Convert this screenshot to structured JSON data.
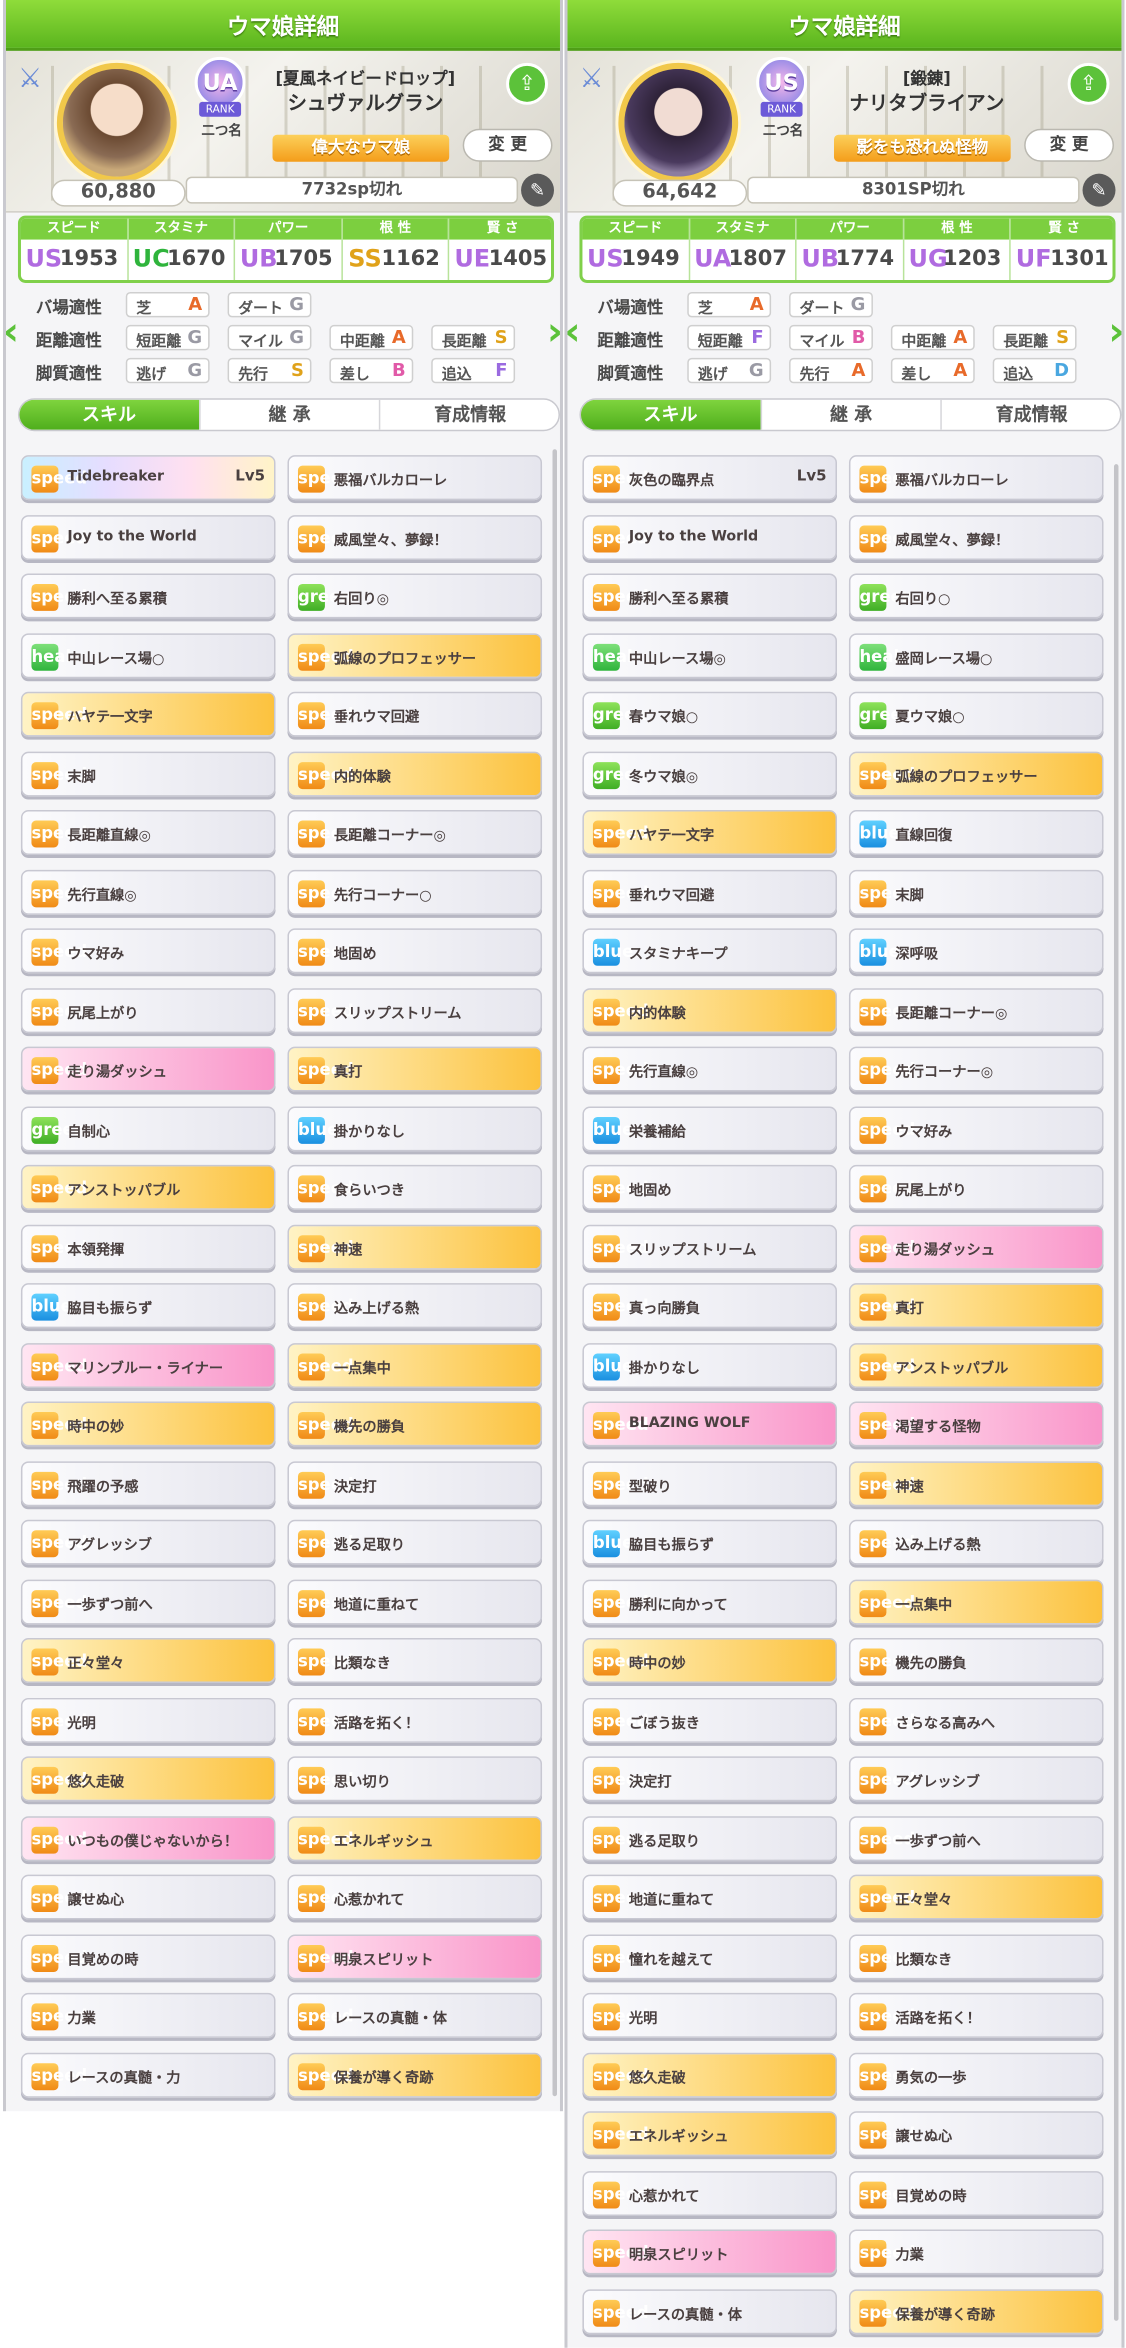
{
  "panels": [
    {
      "title": "ウマ娘詳細",
      "fans": "60,880",
      "rank_badge": "UA",
      "rank_badge_num": "7",
      "rank_label": "RANK",
      "rank_title": "二つ名",
      "epithet": "[夏風ネイビードロップ]",
      "name": "シュヴァルグラン",
      "title_badge": "偉大なウマ娘",
      "change_label": "変 更",
      "sp": "7732sp切れ",
      "stats": [
        {
          "label": "スピード",
          "grade": "US",
          "grade_sub": "5",
          "value": "1953",
          "color": "#b06be0"
        },
        {
          "label": "スタミナ",
          "grade": "UC",
          "grade_sub": "",
          "value": "1670",
          "color": "#2fb43c"
        },
        {
          "label": "パワー",
          "grade": "UB",
          "grade_sub": "",
          "value": "1705",
          "color": "#b06be0"
        },
        {
          "label": "根 性",
          "grade": "SS",
          "grade_sub": "",
          "value": "1162",
          "color": "#e0a21a"
        },
        {
          "label": "賢 さ",
          "grade": "UE",
          "grade_sub": "",
          "value": "1405",
          "color": "#b06be0"
        }
      ],
      "aptitude": [
        {
          "label": "バ場適性",
          "cells": [
            [
              "芝",
              "A"
            ],
            [
              "ダート",
              "G"
            ]
          ]
        },
        {
          "label": "距離適性",
          "cells": [
            [
              "短距離",
              "G"
            ],
            [
              "マイル",
              "G"
            ],
            [
              "中距離",
              "A"
            ],
            [
              "長距離",
              "S"
            ]
          ]
        },
        {
          "label": "脚質適性",
          "cells": [
            [
              "逃げ",
              "G"
            ],
            [
              "先行",
              "S"
            ],
            [
              "差し",
              "B"
            ],
            [
              "追込",
              "F"
            ]
          ]
        }
      ],
      "tabs": [
        "スキル",
        "継 承",
        "育成情報"
      ],
      "skills": [
        [
          "Tidebreaker",
          "rainbow",
          "speed",
          "Lv5"
        ],
        [
          "悪福バルカローレ",
          "white",
          "speed",
          ""
        ],
        [
          "Joy to the World",
          "white",
          "speed",
          ""
        ],
        [
          "威風堂々、夢録！",
          "white",
          "speed",
          ""
        ],
        [
          "勝利へ至る累積",
          "white",
          "speed",
          ""
        ],
        [
          "右回り◎",
          "white",
          "green",
          ""
        ],
        [
          "中山レース場○",
          "white",
          "heal",
          ""
        ],
        [
          "弧線のプロフェッサー",
          "gold",
          "speed",
          ""
        ],
        [
          "ハヤテ一文字",
          "gold",
          "speed",
          ""
        ],
        [
          "垂れウマ回避",
          "white",
          "speed",
          ""
        ],
        [
          "末脚",
          "white",
          "speed",
          ""
        ],
        [
          "内的体験",
          "gold",
          "speed",
          ""
        ],
        [
          "長距離直線◎",
          "white",
          "speed",
          ""
        ],
        [
          "長距離コーナー◎",
          "white",
          "speed",
          ""
        ],
        [
          "先行直線◎",
          "white",
          "speed",
          ""
        ],
        [
          "先行コーナー○",
          "white",
          "speed",
          ""
        ],
        [
          "ウマ好み",
          "white",
          "speed",
          ""
        ],
        [
          "地固め",
          "white",
          "speed",
          ""
        ],
        [
          "尻尾上がり",
          "white",
          "speed",
          ""
        ],
        [
          "スリップストリーム",
          "white",
          "speed",
          ""
        ],
        [
          "走り湯ダッシュ",
          "pink",
          "speed",
          ""
        ],
        [
          "真打",
          "gold",
          "speed",
          ""
        ],
        [
          "自制心",
          "white",
          "green",
          ""
        ],
        [
          "掛かりなし",
          "white",
          "blue",
          ""
        ],
        [
          "アンストッパブル",
          "gold",
          "speed",
          ""
        ],
        [
          "食らいつき",
          "white",
          "speed",
          ""
        ],
        [
          "本領発揮",
          "white",
          "speed",
          ""
        ],
        [
          "神速",
          "gold",
          "speed",
          ""
        ],
        [
          "脇目も振らず",
          "white",
          "blue",
          ""
        ],
        [
          "込み上げる熱",
          "white",
          "speed",
          ""
        ],
        [
          "マリンブルー・ライナー",
          "pink",
          "speed",
          ""
        ],
        [
          "一点集中",
          "gold",
          "speed",
          ""
        ],
        [
          "時中の妙",
          "gold",
          "speed",
          ""
        ],
        [
          "機先の勝負",
          "gold",
          "speed",
          ""
        ],
        [
          "飛躍の予感",
          "white",
          "speed",
          ""
        ],
        [
          "決定打",
          "white",
          "speed",
          ""
        ],
        [
          "アグレッシブ",
          "white",
          "speed",
          ""
        ],
        [
          "逃る足取り",
          "white",
          "speed",
          ""
        ],
        [
          "一歩ずつ前へ",
          "white",
          "speed",
          ""
        ],
        [
          "地道に重ねて",
          "white",
          "speed",
          ""
        ],
        [
          "正々堂々",
          "gold",
          "speed",
          ""
        ],
        [
          "比類なき",
          "white",
          "speed",
          ""
        ],
        [
          "光明",
          "white",
          "speed",
          ""
        ],
        [
          "活路を拓く！",
          "white",
          "speed",
          ""
        ],
        [
          "悠久走破",
          "gold",
          "speed",
          ""
        ],
        [
          "思い切り",
          "white",
          "speed",
          ""
        ],
        [
          "いつもの僕じゃないから！",
          "pink",
          "speed",
          ""
        ],
        [
          "エネルギッシュ",
          "gold",
          "speed",
          ""
        ],
        [
          "譲せぬ心",
          "white",
          "speed",
          ""
        ],
        [
          "心惹かれて",
          "white",
          "speed",
          ""
        ],
        [
          "目覚めの時",
          "white",
          "speed",
          ""
        ],
        [
          "明泉スピリット",
          "pink",
          "speed",
          ""
        ],
        [
          "力業",
          "white",
          "speed",
          ""
        ],
        [
          "レースの真髄・体",
          "white",
          "speed",
          ""
        ],
        [
          "レースの真髄・力",
          "white",
          "speed",
          ""
        ],
        [
          "保養が導く奇跡",
          "gold",
          "speed",
          ""
        ]
      ]
    },
    {
      "title": "ウマ娘詳細",
      "fans": "64,642",
      "rank_badge": "US",
      "rank_badge_num": "",
      "rank_label": "RANK",
      "rank_title": "二つ名",
      "epithet": "[鍛錬]",
      "name": "ナリタブライアン",
      "title_badge": "影をも恐れぬ怪物",
      "change_label": "変 更",
      "sp": "8301SP切れ",
      "stats": [
        {
          "label": "スピード",
          "grade": "US",
          "grade_sub": "5",
          "value": "1949",
          "color": "#b06be0"
        },
        {
          "label": "スタミナ",
          "grade": "UA",
          "grade_sub": "",
          "value": "1807",
          "color": "#b06be0"
        },
        {
          "label": "パワー",
          "grade": "UB",
          "grade_sub": "7",
          "value": "1774",
          "color": "#b06be0"
        },
        {
          "label": "根 性",
          "grade": "UG",
          "grade_sub": "",
          "value": "1203",
          "color": "#b06be0"
        },
        {
          "label": "賢 さ",
          "grade": "UF",
          "grade_sub": "",
          "value": "1301",
          "color": "#b06be0"
        }
      ],
      "aptitude": [
        {
          "label": "バ場適性",
          "cells": [
            [
              "芝",
              "A"
            ],
            [
              "ダート",
              "G"
            ]
          ]
        },
        {
          "label": "距離適性",
          "cells": [
            [
              "短距離",
              "F"
            ],
            [
              "マイル",
              "B"
            ],
            [
              "中距離",
              "A"
            ],
            [
              "長距離",
              "S"
            ]
          ]
        },
        {
          "label": "脚質適性",
          "cells": [
            [
              "逃げ",
              "G"
            ],
            [
              "先行",
              "A"
            ],
            [
              "差し",
              "A"
            ],
            [
              "追込",
              "D"
            ]
          ]
        }
      ],
      "tabs": [
        "スキル",
        "継 承",
        "育成情報"
      ],
      "skills": [
        [
          "灰色の臨界点",
          "white",
          "speed",
          "Lv5"
        ],
        [
          "悪福バルカローレ",
          "white",
          "speed",
          ""
        ],
        [
          "Joy to the World",
          "white",
          "speed",
          ""
        ],
        [
          "威風堂々、夢録！",
          "white",
          "speed",
          ""
        ],
        [
          "勝利へ至る累積",
          "white",
          "speed",
          ""
        ],
        [
          "右回り○",
          "white",
          "green",
          ""
        ],
        [
          "中山レース場◎",
          "white",
          "heal",
          ""
        ],
        [
          "盛岡レース場○",
          "white",
          "heal",
          ""
        ],
        [
          "春ウマ娘○",
          "white",
          "green",
          ""
        ],
        [
          "夏ウマ娘○",
          "white",
          "green",
          ""
        ],
        [
          "冬ウマ娘◎",
          "white",
          "green",
          ""
        ],
        [
          "弧線のプロフェッサー",
          "gold",
          "speed",
          ""
        ],
        [
          "ハヤテ一文字",
          "gold",
          "speed",
          ""
        ],
        [
          "直線回復",
          "white",
          "blue",
          ""
        ],
        [
          "垂れウマ回避",
          "white",
          "speed",
          ""
        ],
        [
          "末脚",
          "white",
          "speed",
          ""
        ],
        [
          "スタミナキープ",
          "white",
          "blue",
          ""
        ],
        [
          "深呼吸",
          "white",
          "blue",
          ""
        ],
        [
          "内的体験",
          "gold",
          "speed",
          ""
        ],
        [
          "長距離コーナー◎",
          "white",
          "speed",
          ""
        ],
        [
          "先行直線◎",
          "white",
          "speed",
          ""
        ],
        [
          "先行コーナー◎",
          "white",
          "speed",
          ""
        ],
        [
          "栄養補給",
          "white",
          "blue",
          ""
        ],
        [
          "ウマ好み",
          "white",
          "speed",
          ""
        ],
        [
          "地固め",
          "white",
          "speed",
          ""
        ],
        [
          "尻尾上がり",
          "white",
          "speed",
          ""
        ],
        [
          "スリップストリーム",
          "white",
          "speed",
          ""
        ],
        [
          "走り湯ダッシュ",
          "pink",
          "speed",
          ""
        ],
        [
          "真っ向勝負",
          "white",
          "speed",
          ""
        ],
        [
          "真打",
          "gold",
          "speed",
          ""
        ],
        [
          "掛かりなし",
          "white",
          "blue",
          ""
        ],
        [
          "アンストッパブル",
          "gold",
          "speed",
          ""
        ],
        [
          "BLAZING WOLF",
          "pink",
          "speed",
          ""
        ],
        [
          "渇望する怪物",
          "pink",
          "speed",
          ""
        ],
        [
          "型破り",
          "white",
          "speed",
          ""
        ],
        [
          "神速",
          "gold",
          "speed",
          ""
        ],
        [
          "脇目も振らず",
          "white",
          "blue",
          ""
        ],
        [
          "込み上げる熱",
          "white",
          "speed",
          ""
        ],
        [
          "勝利に向かって",
          "white",
          "speed",
          ""
        ],
        [
          "一点集中",
          "gold",
          "speed",
          ""
        ],
        [
          "時中の妙",
          "gold",
          "speed",
          ""
        ],
        [
          "機先の勝負",
          "white",
          "speed",
          ""
        ],
        [
          "ごぼう抜き",
          "white",
          "speed",
          ""
        ],
        [
          "さらなる高みへ",
          "white",
          "speed",
          ""
        ],
        [
          "決定打",
          "white",
          "speed",
          ""
        ],
        [
          "アグレッシブ",
          "white",
          "speed",
          ""
        ],
        [
          "逃る足取り",
          "white",
          "speed",
          ""
        ],
        [
          "一歩ずつ前へ",
          "white",
          "speed",
          ""
        ],
        [
          "地道に重ねて",
          "white",
          "speed",
          ""
        ],
        [
          "正々堂々",
          "gold",
          "speed",
          ""
        ],
        [
          "憧れを越えて",
          "white",
          "speed",
          ""
        ],
        [
          "比類なき",
          "white",
          "speed",
          ""
        ],
        [
          "光明",
          "white",
          "speed",
          ""
        ],
        [
          "活路を拓く！",
          "white",
          "speed",
          ""
        ],
        [
          "悠久走破",
          "gold",
          "speed",
          ""
        ],
        [
          "勇気の一歩",
          "white",
          "speed",
          ""
        ],
        [
          "エネルギッシュ",
          "gold",
          "speed",
          ""
        ],
        [
          "譲せぬ心",
          "white",
          "speed",
          ""
        ],
        [
          "心惹かれて",
          "white",
          "speed",
          ""
        ],
        [
          "目覚めの時",
          "white",
          "speed",
          ""
        ],
        [
          "明泉スピリット",
          "pink",
          "speed",
          ""
        ],
        [
          "力業",
          "white",
          "speed",
          ""
        ],
        [
          "レースの真髄・体",
          "white",
          "speed",
          ""
        ],
        [
          "保養が導く奇跡",
          "gold",
          "speed",
          ""
        ]
      ]
    }
  ]
}
